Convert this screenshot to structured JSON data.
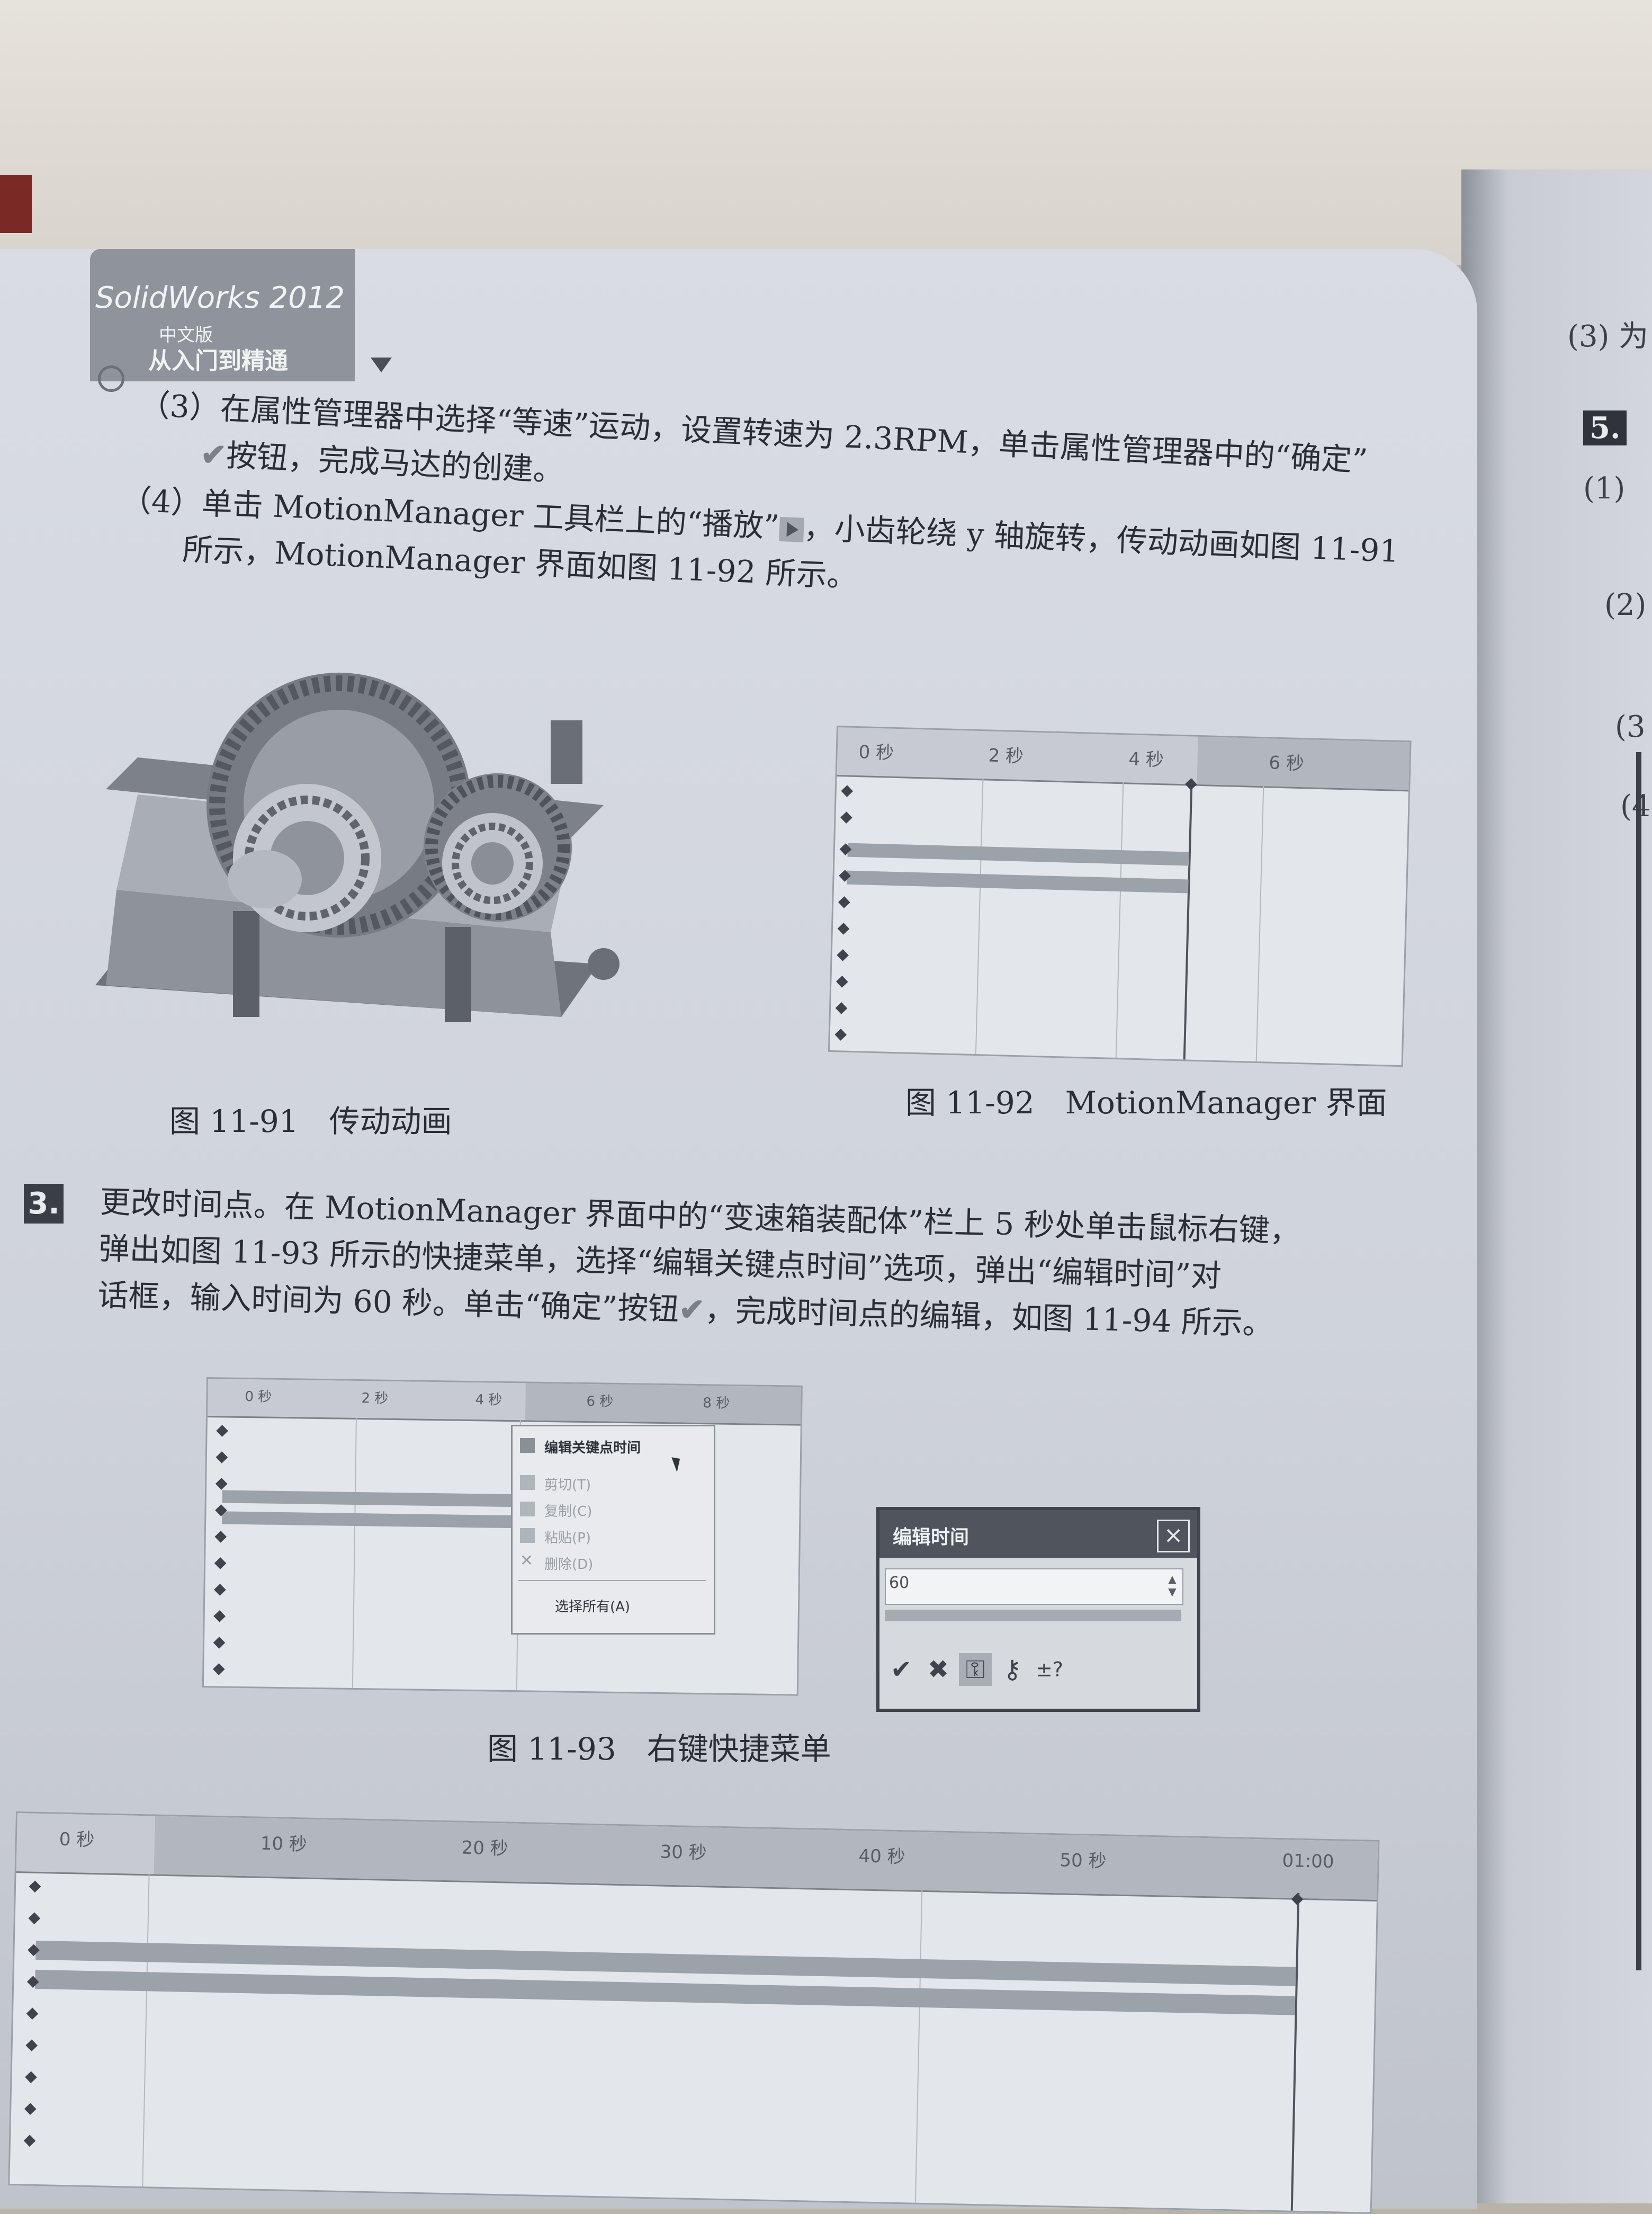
{
  "header": {
    "logo_line1": "SolidWorks 2012",
    "logo_line2": "中文版",
    "logo_line3": "从入门到精通"
  },
  "paragraphs": {
    "p3_line1": "（3）在属性管理器中选择“等速”运动，设置转速为 2.3RPM，单击属性管理器中的“确定”",
    "p3_line2_icon": "check-icon",
    "p3_line2_text": "按钮，完成马达的创建。",
    "p4_line1_a": "（4）单击 MotionManager 工具栏上的“播放”",
    "p4_line1_icon": "play-icon",
    "p4_line1_b": "，小齿轮绕 y 轴旋转，传动动画如图 11-91",
    "p4_line2": "所示，MotionManager 界面如图 11-92 所示。"
  },
  "figures": {
    "fig91_caption": "图 11-91　传动动画",
    "fig92_caption": "图 11-92　MotionManager 界面",
    "fig93_caption": "图 11-93　右键快捷菜单"
  },
  "step3": {
    "badge": "3.",
    "line1": "更改时间点。在 MotionManager 界面中的“变速箱装配体”栏上 5 秒处单击鼠标右键，",
    "line2": "弹出如图 11-93 所示的快捷菜单，选择“编辑关键点时间”选项，弹出“编辑时间”对",
    "line3_a": "话框，输入时间为 60 秒。单击“确定”按钮",
    "line3_icon": "check-icon",
    "line3_b": "，完成时间点的编辑，如图 11-94 所示。"
  },
  "timeline_92": {
    "ticks": [
      "0 秒",
      "2 秒",
      "4 秒",
      "6 秒"
    ]
  },
  "timeline_93": {
    "ticks": [
      "0 秒",
      "2 秒",
      "4 秒",
      "6 秒",
      "8 秒"
    ]
  },
  "timeline_94": {
    "ticks": [
      "0 秒",
      "10 秒",
      "20 秒",
      "30 秒",
      "40 秒",
      "50 秒",
      "01:00"
    ]
  },
  "context_menu": {
    "items": [
      "编辑关键点时间",
      "剪切(T)",
      "复制(C)",
      "粘贴(P)",
      "删除(D)",
      "选择所有(A)"
    ]
  },
  "edit_dialog": {
    "title": "编辑时间",
    "value": "60",
    "buttons": [
      "check-icon",
      "close-icon",
      "key-icon",
      "key-plus-icon",
      "plus-minus-question-icon"
    ]
  },
  "next_page": {
    "items": [
      "(3) 为",
      "5.",
      "(1)",
      "(2)",
      "(3",
      "(4"
    ]
  },
  "colors": {
    "page": "#d9dde3",
    "ink": "#2a2d33",
    "badge": "#3a3e46"
  }
}
